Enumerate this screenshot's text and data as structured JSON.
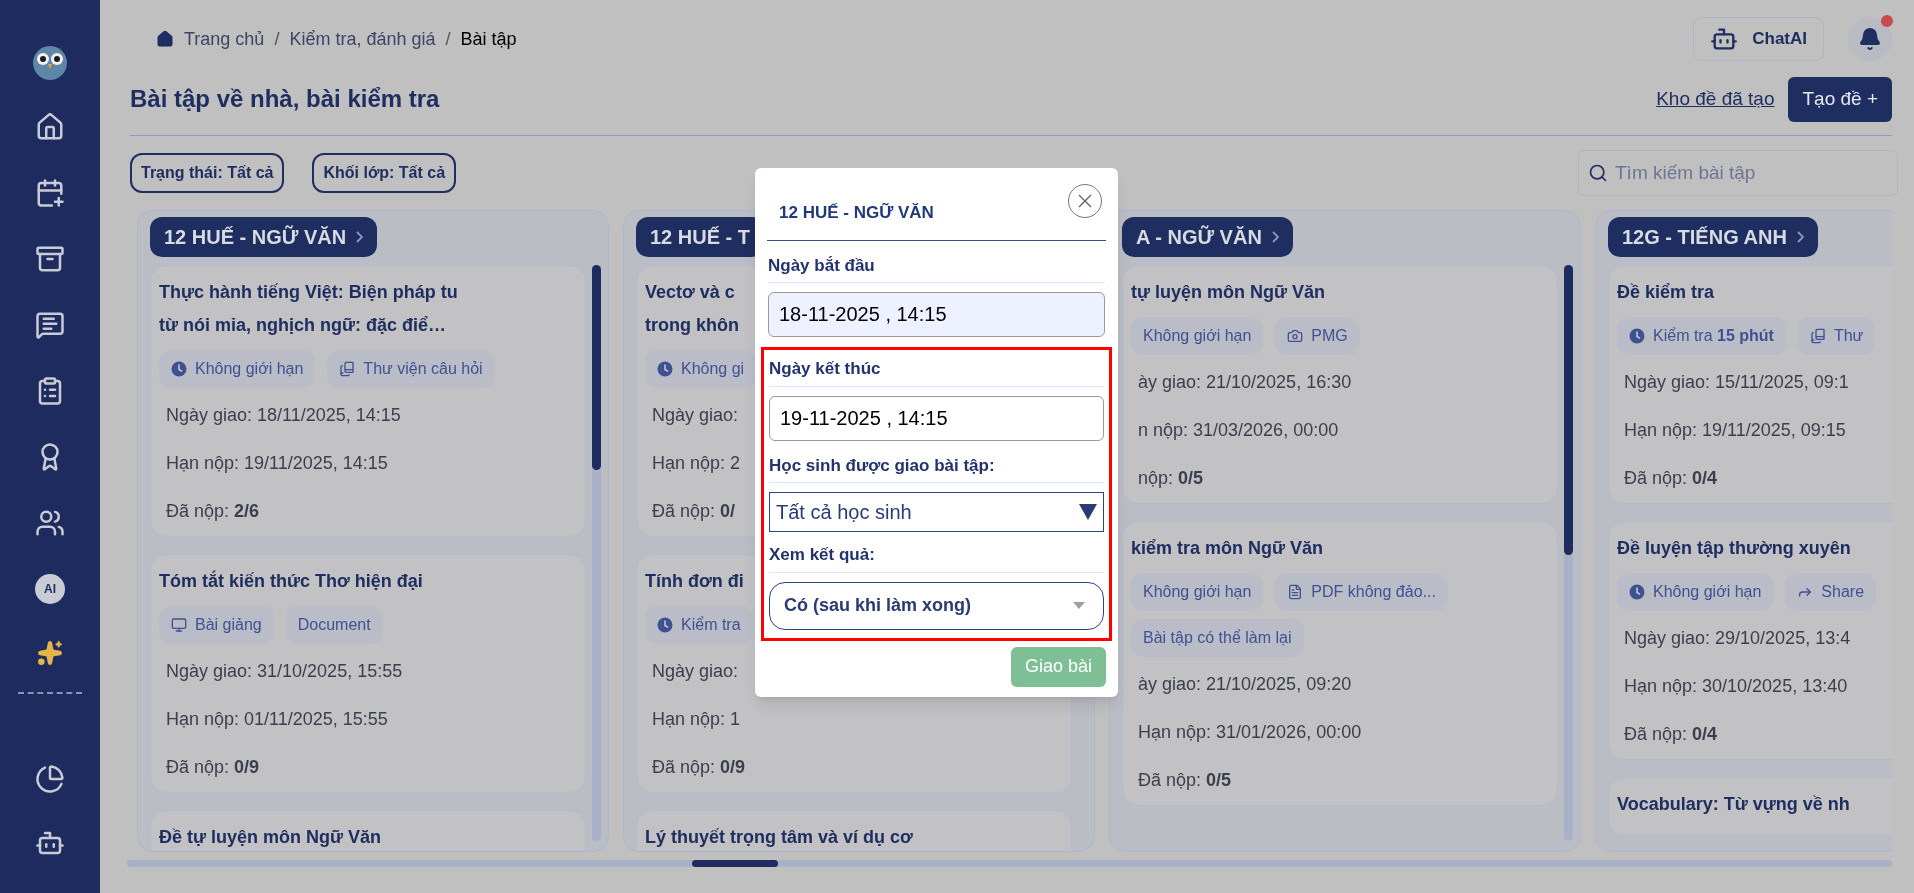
{
  "sidebar": {
    "ai_label": "AI"
  },
  "breadcrumb_separator": "/",
  "breadcrumb": [
    {
      "text": "Trang chủ",
      "current": false
    },
    {
      "text": "Kiểm tra, đánh giá",
      "current": false
    },
    {
      "text": "Bài tập",
      "current": true
    }
  ],
  "chat_button": "ChatAI",
  "notifications": {
    "unread": true
  },
  "page_title": "Bài tập về nhà, bài kiểm tra",
  "library_link": "Kho đề đã tạo",
  "create_button": "Tạo đề +",
  "filters": [
    "Trạng thái: Tất cả",
    "Khối lớp: Tất cả"
  ],
  "search": {
    "placeholder": "Tìm kiếm bài tập"
  },
  "columns": [
    {
      "title": "12 HUẾ - NGỮ VĂN",
      "chevron": true,
      "cards": [
        {
          "title_lines": [
            "Thực hành tiếng Việt: Biện pháp tu",
            "từ nói mỉa, nghịch ngữ: đặc điể…"
          ],
          "chips": [
            {
              "kind": "time",
              "text": "Không giới hạn"
            },
            {
              "kind": "library",
              "text": "Thư viện câu hỏi"
            }
          ],
          "lines": [
            "Ngày giao: 18/11/2025, 14:15",
            "Hạn nộp: 19/11/2025, 14:15",
            "Đã nộp: **2/6**"
          ]
        },
        {
          "title_lines": [
            "Tóm tắt kiến thức Thơ hiện đại"
          ],
          "chips": [
            {
              "kind": "lesson",
              "text": "Bài giảng"
            },
            {
              "kind": "plain",
              "text": "Document"
            }
          ],
          "lines": [
            "Ngày giao: 31/10/2025, 15:55",
            "Hạn nộp: 01/11/2025, 15:55",
            "Đã nộp: **0/9**"
          ]
        },
        {
          "title_lines": [
            "Đề tự luyện môn Ngữ Văn"
          ]
        }
      ]
    },
    {
      "title": "12 HUẾ - T",
      "chevron": false,
      "cards": [
        {
          "title_lines": [
            "Vectơ và c",
            "trong khôn"
          ],
          "chips": [
            {
              "kind": "time",
              "text": "Không gi"
            }
          ],
          "lines": [
            "Ngày giao:",
            "Hạn nộp: 2",
            "Đã nộp: **0/**"
          ]
        },
        {
          "title_lines": [
            "Tính đơn đi"
          ],
          "chips": [
            {
              "kind": "time",
              "text": "Kiểm tra"
            }
          ],
          "lines": [
            "Ngày giao:",
            "Hạn nộp: 1",
            "Đã nộp: **0/9**"
          ]
        },
        {
          "title_lines": [
            "Lý thuyết trọng tâm và ví dụ cơ"
          ]
        }
      ]
    },
    {
      "title": "A - NGỮ VĂN",
      "chevron": true,
      "cards": [
        {
          "title_lines": [
            "tự luyện môn Ngữ Văn"
          ],
          "chips": [
            {
              "kind": "plain",
              "text": "Không giới hạn"
            },
            {
              "kind": "camera",
              "text": "PMG"
            }
          ],
          "lines": [
            "ày giao: 21/10/2025, 16:30",
            "n nộp: 31/03/2026, 00:00",
            "nộp: **0/5**"
          ]
        },
        {
          "title_lines": [
            "kiểm tra môn Ngữ Văn"
          ],
          "chips": [
            {
              "kind": "plain",
              "text": "Không giới hạn"
            },
            {
              "kind": "pdf",
              "text": "PDF không đảo..."
            },
            {
              "kind": "plain",
              "text": "Bài tập có thể làm lại"
            }
          ],
          "lines": [
            "ày giao: 21/10/2025, 09:20",
            "Hạn nộp: 31/01/2026, 00:00",
            "Đã nộp: **0/5**"
          ]
        }
      ]
    },
    {
      "title": "12G - TIẾNG ANH",
      "chevron": true,
      "cards": [
        {
          "title_lines": [
            "Đề kiểm tra"
          ],
          "chips": [
            {
              "kind": "time",
              "text": "Kiểm tra **15 phút**"
            },
            {
              "kind": "library",
              "text": "Thư"
            }
          ],
          "lines": [
            "Ngày giao: 15/11/2025, 09:1",
            "Hạn nộp: 19/11/2025, 09:15",
            "Đã nộp: **0/4**"
          ]
        },
        {
          "title_lines": [
            "Đề luyện tập thường xuyên"
          ],
          "chips": [
            {
              "kind": "time",
              "text": "Không giới hạn"
            },
            {
              "kind": "share",
              "text": "Share"
            }
          ],
          "lines": [
            "Ngày giao: 29/10/2025, 13:4",
            "Hạn nộp: 30/10/2025, 13:40",
            "Đã nộp: **0/4**"
          ]
        },
        {
          "title_lines": [
            "Vocabulary: Từ vựng về nh"
          ]
        }
      ]
    }
  ],
  "dialog": {
    "title": "12 HUẾ - NGỮ VĂN",
    "fields": [
      {
        "kind": "date",
        "label": "Ngày bắt đầu",
        "value": "18-11-2025 , 14:15",
        "disabled": true,
        "highlighted": false
      },
      {
        "kind": "date",
        "label": "Ngày kết thúc",
        "value": "19-11-2025 , 14:15",
        "disabled": false,
        "highlighted": true
      },
      {
        "kind": "select",
        "label": "Học sinh được giao bài tập:",
        "value": "Tất cả học sinh",
        "highlighted": true
      },
      {
        "kind": "dropdown",
        "label": "Xem kết quả:",
        "value": "Có (sau khi làm xong)",
        "highlighted": true
      }
    ],
    "submit": {
      "text": "Giao bài",
      "disabled": true
    }
  }
}
